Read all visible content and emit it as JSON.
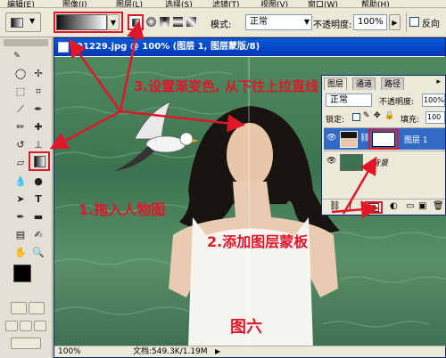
{
  "menu": [
    "编辑(E)",
    "图像(I)",
    "图层(L)",
    "选择(S)",
    "滤镜(T)",
    "视图(V)",
    "窗口(W)",
    "帮助(H)"
  ],
  "options": {
    "mode_label": "模式:",
    "mode_value": "正常",
    "opacity_label": "不透明度:",
    "opacity_value": "100%",
    "reverse_label": "反向"
  },
  "document": {
    "title": "91229.jpg @ 100% (图层 1, 图层蒙版/8)",
    "zoom": "100%",
    "doc_size": "文档:549.3K/1.19M"
  },
  "layers_panel": {
    "tabs": [
      "图层",
      "通道",
      "路径"
    ],
    "blend_mode": "正常",
    "opacity_label": "不透明度:",
    "opacity_value": "100%",
    "lock_label": "锁定:",
    "fill_label": "填充:",
    "fill_value": "100",
    "layers": [
      {
        "name": "图层 1"
      },
      {
        "name": "背景"
      }
    ]
  },
  "annotations": {
    "step1": "1.拖入人物图",
    "step2": "2.添加图层蒙板",
    "step3": "3.设置渐变色, 从下往上拉直线",
    "caption": "图六"
  },
  "colors": {
    "annotation": "#e0162a",
    "title_bar": "#0a46c8",
    "ui_bg": "#ece9d8"
  }
}
